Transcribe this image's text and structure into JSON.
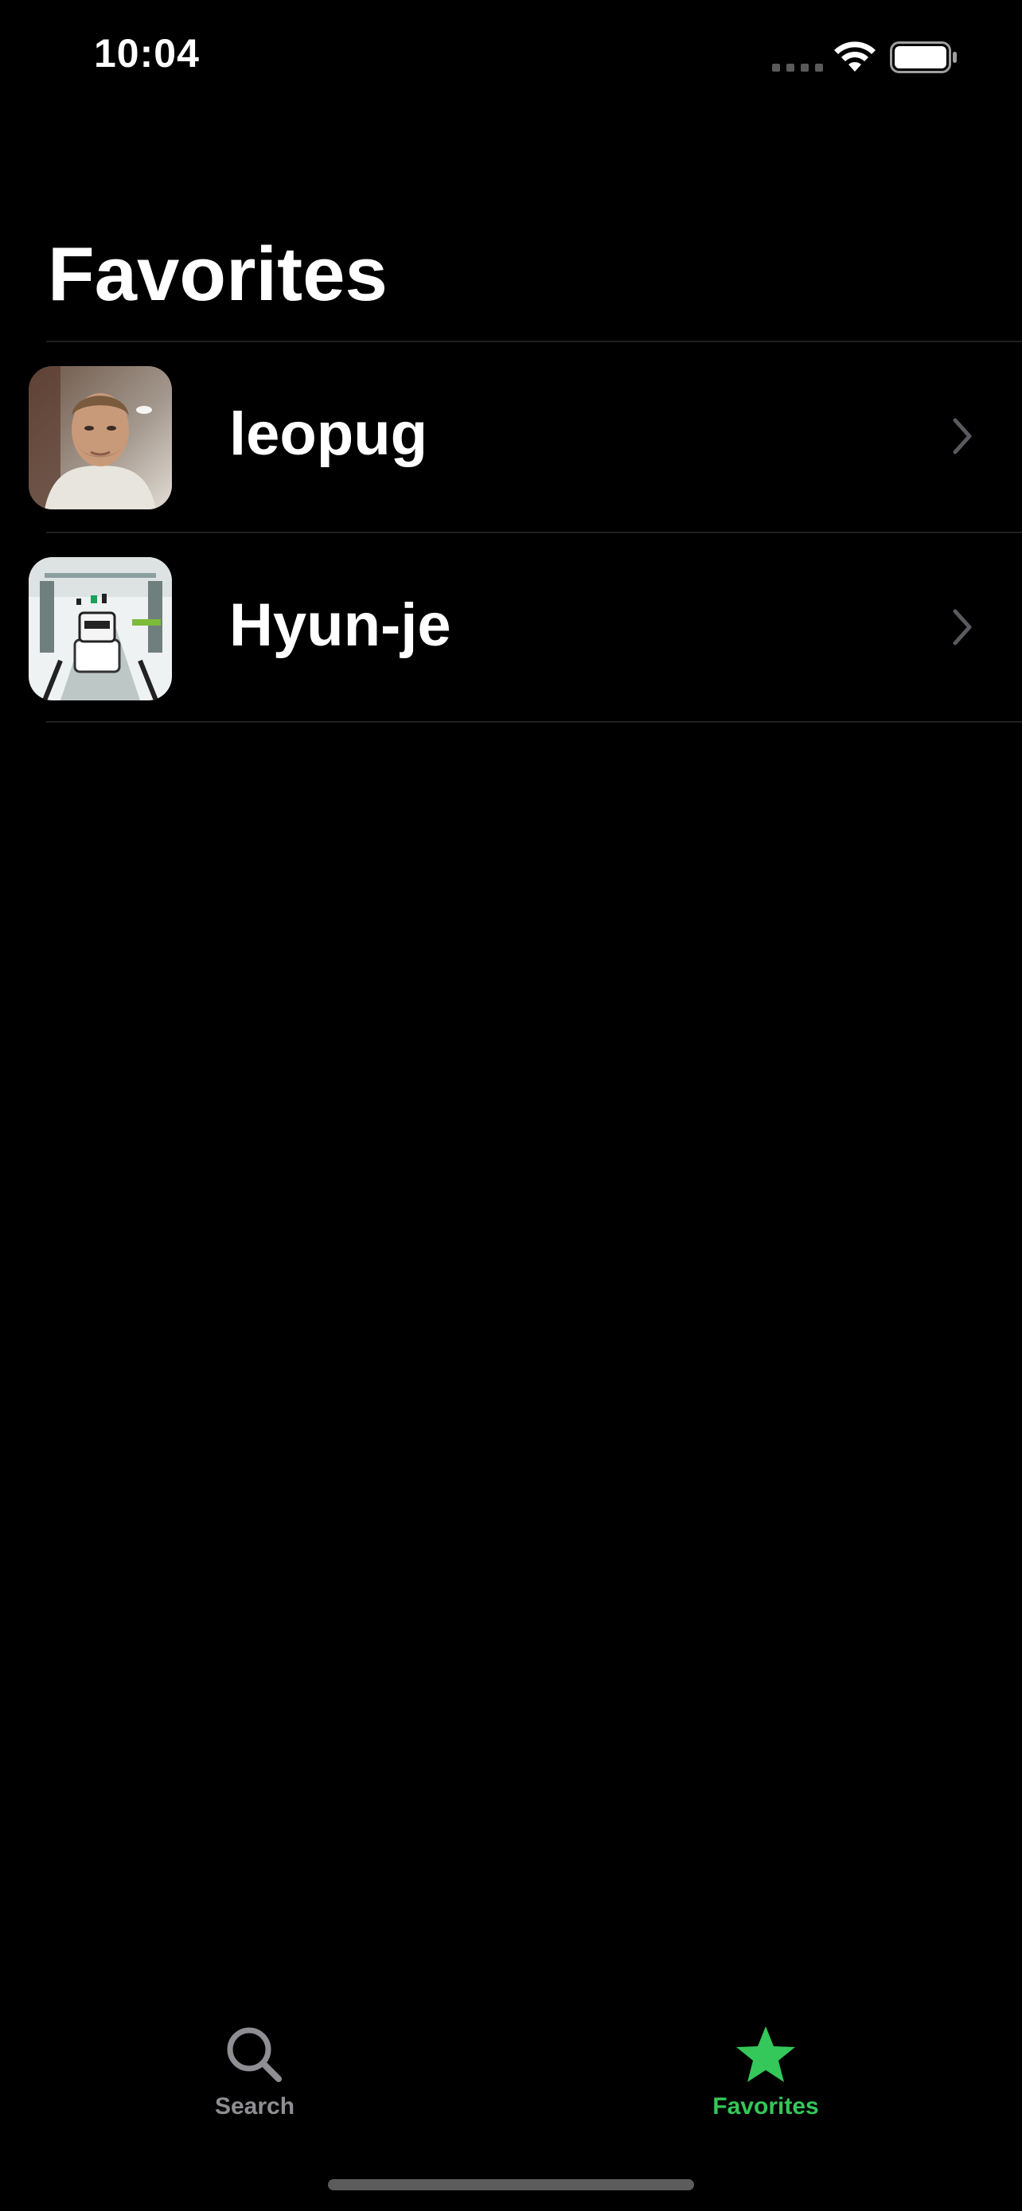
{
  "status_bar": {
    "time": "10:04"
  },
  "header": {
    "title": "Favorites"
  },
  "favorites": [
    {
      "name": "leopug",
      "avatar": "person-photo"
    },
    {
      "name": "Hyun-je",
      "avatar": "robot-photo"
    }
  ],
  "tab_bar": {
    "tabs": [
      {
        "label": "Search",
        "icon": "magnifier-icon",
        "selected": false
      },
      {
        "label": "Favorites",
        "icon": "star-icon",
        "selected": true
      }
    ]
  },
  "colors": {
    "background": "#000000",
    "accent": "#34c759",
    "inactive": "#8e8e93",
    "separator": "#1f1f1f"
  }
}
